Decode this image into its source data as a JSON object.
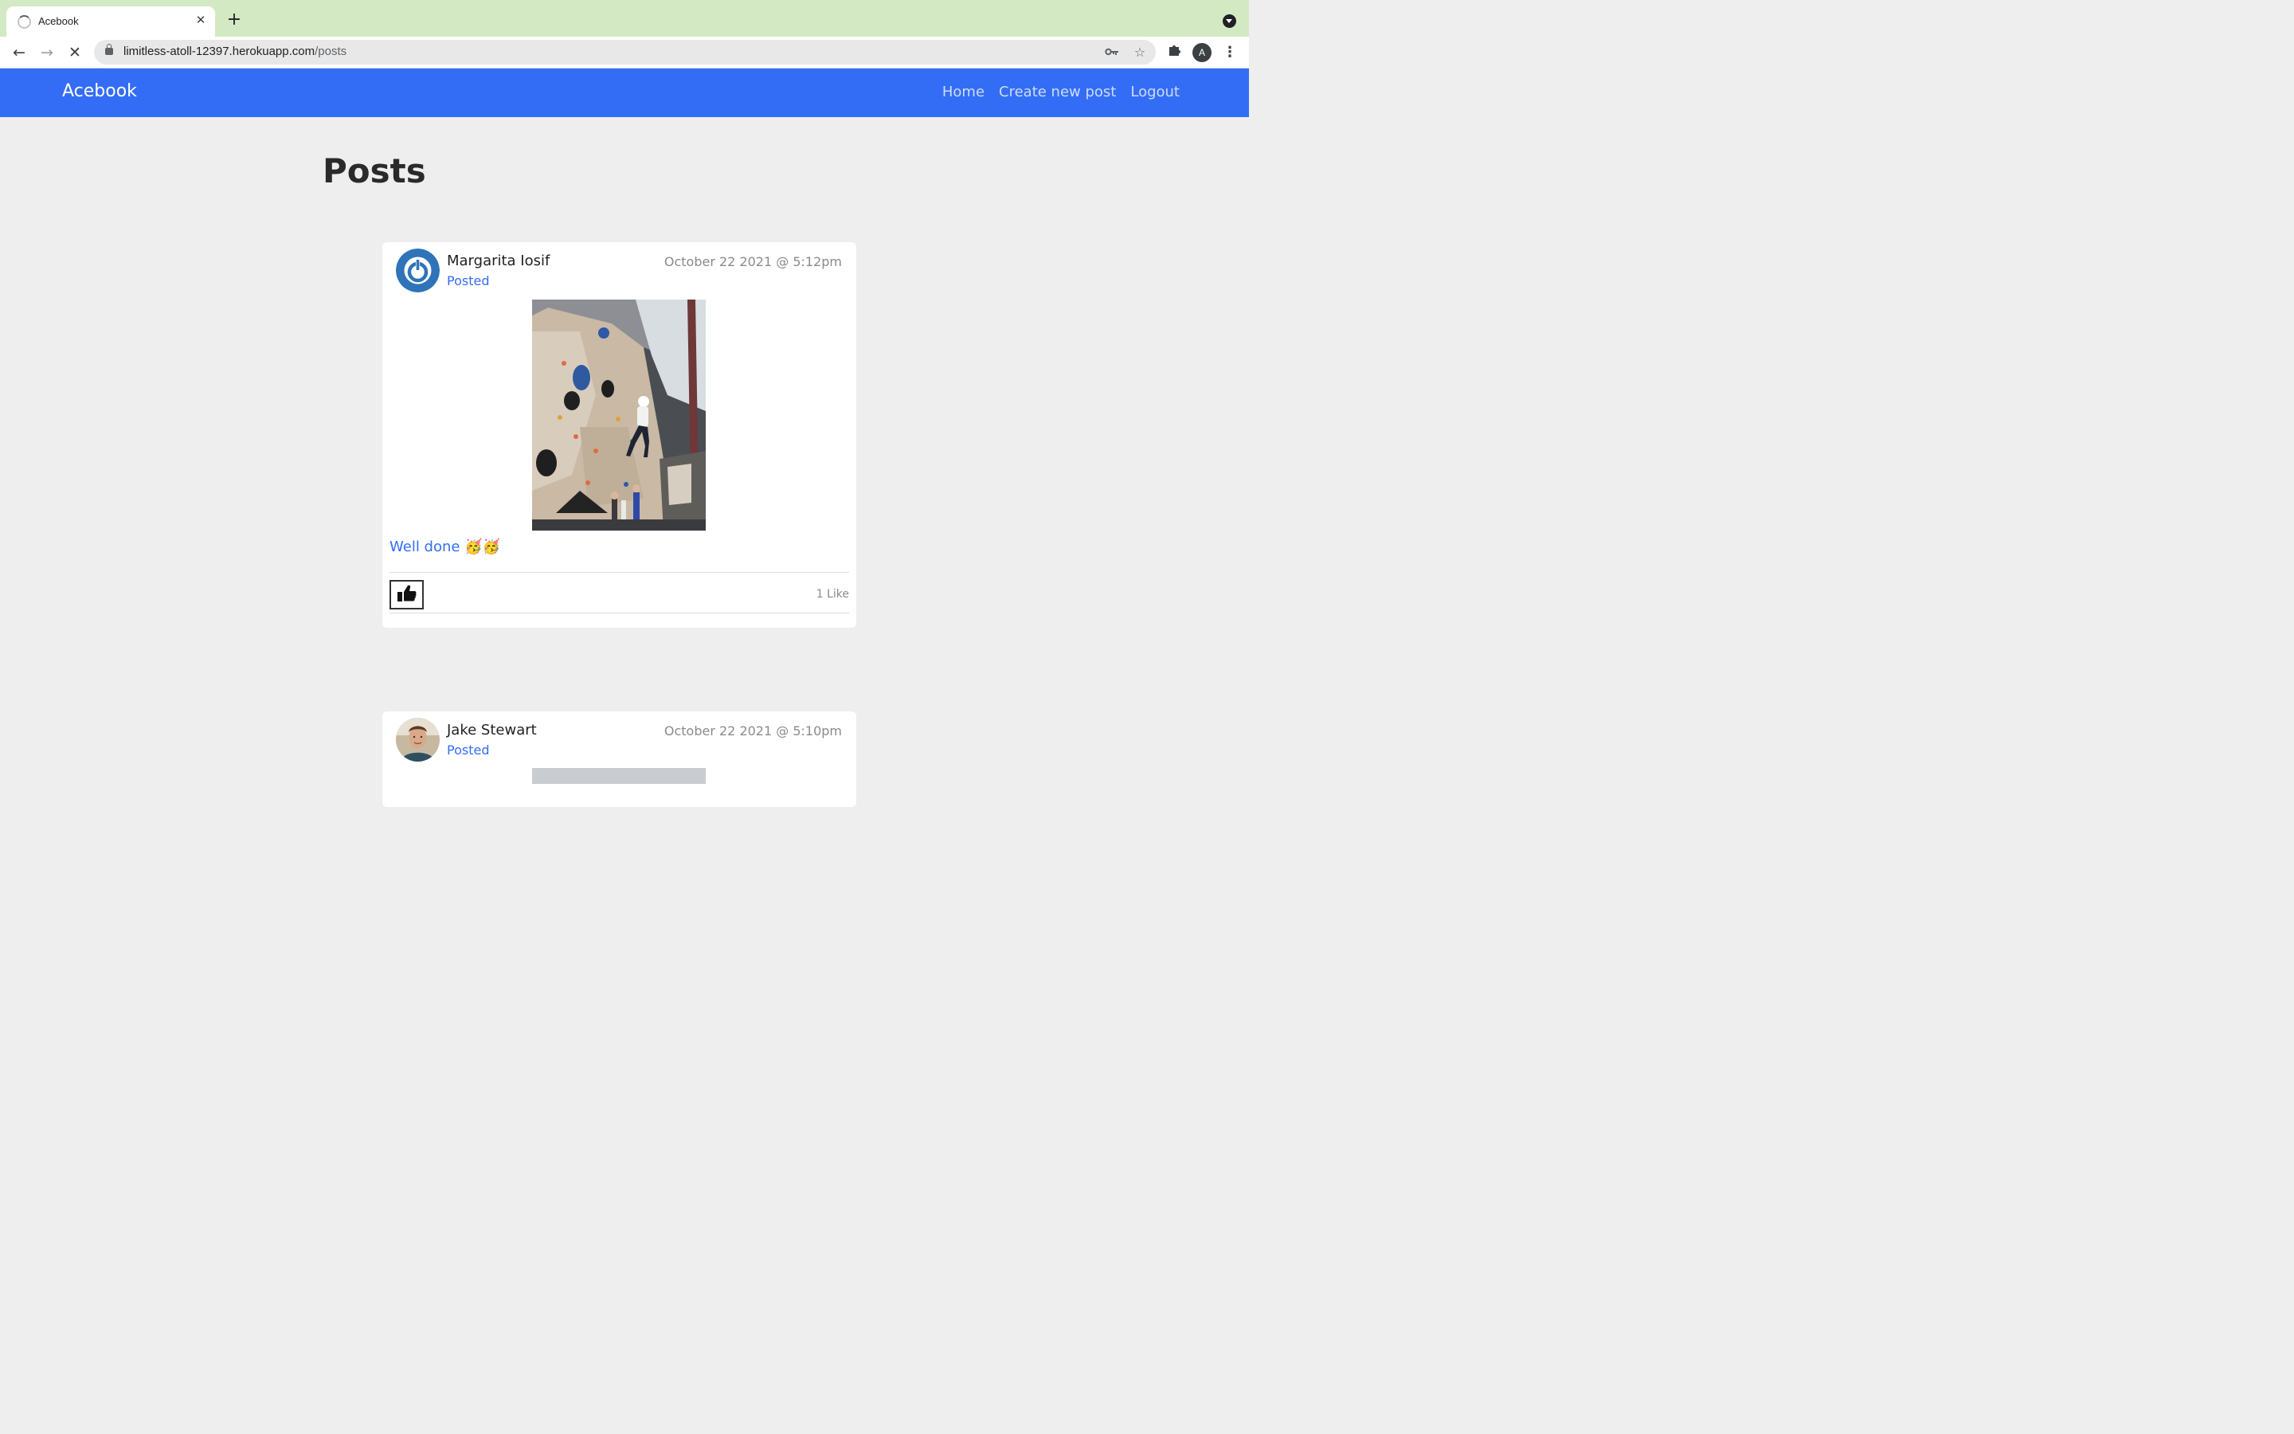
{
  "browser": {
    "tab_title": "Acebook",
    "url_host": "limitless-atoll-12397.herokuapp.com",
    "url_path": "/posts",
    "profile_initial": "A"
  },
  "navbar": {
    "brand": "Acebook",
    "links": [
      "Home",
      "Create new post",
      "Logout"
    ]
  },
  "page": {
    "title": "Posts"
  },
  "posts": [
    {
      "author": "Margarita Iosif",
      "status": "Posted",
      "timestamp": "October 22 2021 @ 5:12pm",
      "text": "Well done 🥳🥳",
      "likes": "1 Like"
    },
    {
      "author": "Jake Stewart",
      "status": "Posted",
      "timestamp": "October 22 2021 @ 5:10pm"
    }
  ],
  "colors": {
    "accent": "#336df6",
    "tabstrip": "#d3e9c3",
    "page_bg": "#eeeeee"
  }
}
